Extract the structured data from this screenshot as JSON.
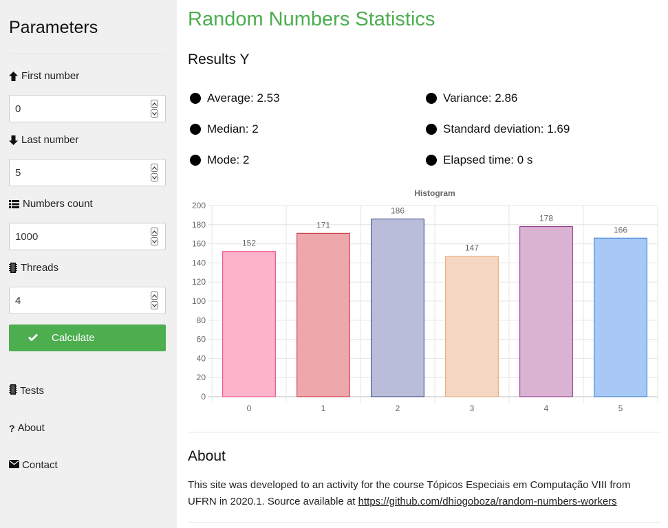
{
  "sidebar": {
    "title": "Parameters",
    "fields": [
      {
        "label": "First number",
        "value": "0",
        "icon": "arrow-up-icon"
      },
      {
        "label": "Last number",
        "value": "5",
        "icon": "arrow-down-icon"
      },
      {
        "label": "Numbers count",
        "value": "1000",
        "icon": "list-icon"
      },
      {
        "label": "Threads",
        "value": "4",
        "icon": "chip-icon"
      }
    ],
    "calculate_label": "Calculate",
    "nav": [
      {
        "label": "Tests",
        "icon": "chip-icon"
      },
      {
        "label": "About",
        "icon": "question-icon"
      },
      {
        "label": "Contact",
        "icon": "envelope-icon"
      }
    ]
  },
  "main": {
    "title": "Random Numbers Statistics",
    "results_title": "Results Y",
    "stats": {
      "average": "Average: 2.53",
      "median": "Median: 2",
      "mode": "Mode: 2",
      "variance": "Variance: 2.86",
      "std_dev": "Standard deviation: 1.69",
      "elapsed": "Elapsed time: 0 s"
    },
    "about_title": "About",
    "about_text": "This site was developed to an activity for the course Tópicos Especiais em Computação VIII from UFRN in 2020.1. Source available at ",
    "about_link": "https://github.com/dhiogoboza/random-numbers-workers"
  },
  "colors": {
    "accent": "#4cae4f"
  },
  "chart_data": {
    "type": "bar",
    "title": "Histogram",
    "categories": [
      "0",
      "1",
      "2",
      "3",
      "4",
      "5"
    ],
    "values": [
      152,
      171,
      186,
      147,
      178,
      166
    ],
    "ylim": [
      0,
      200
    ],
    "yticks": [
      0,
      20,
      40,
      60,
      80,
      100,
      120,
      140,
      160,
      180,
      200
    ],
    "grid": true,
    "legend": "none",
    "bar_fills": [
      "#fcb4cb",
      "#eda8ac",
      "#b9bdd9",
      "#f5d6c3",
      "#dab3d3",
      "#a8c8f6"
    ],
    "bar_strokes": [
      "#ec407a",
      "#cc2b36",
      "#303f80",
      "#e9a26d",
      "#8e2a86",
      "#2e76d4"
    ]
  }
}
